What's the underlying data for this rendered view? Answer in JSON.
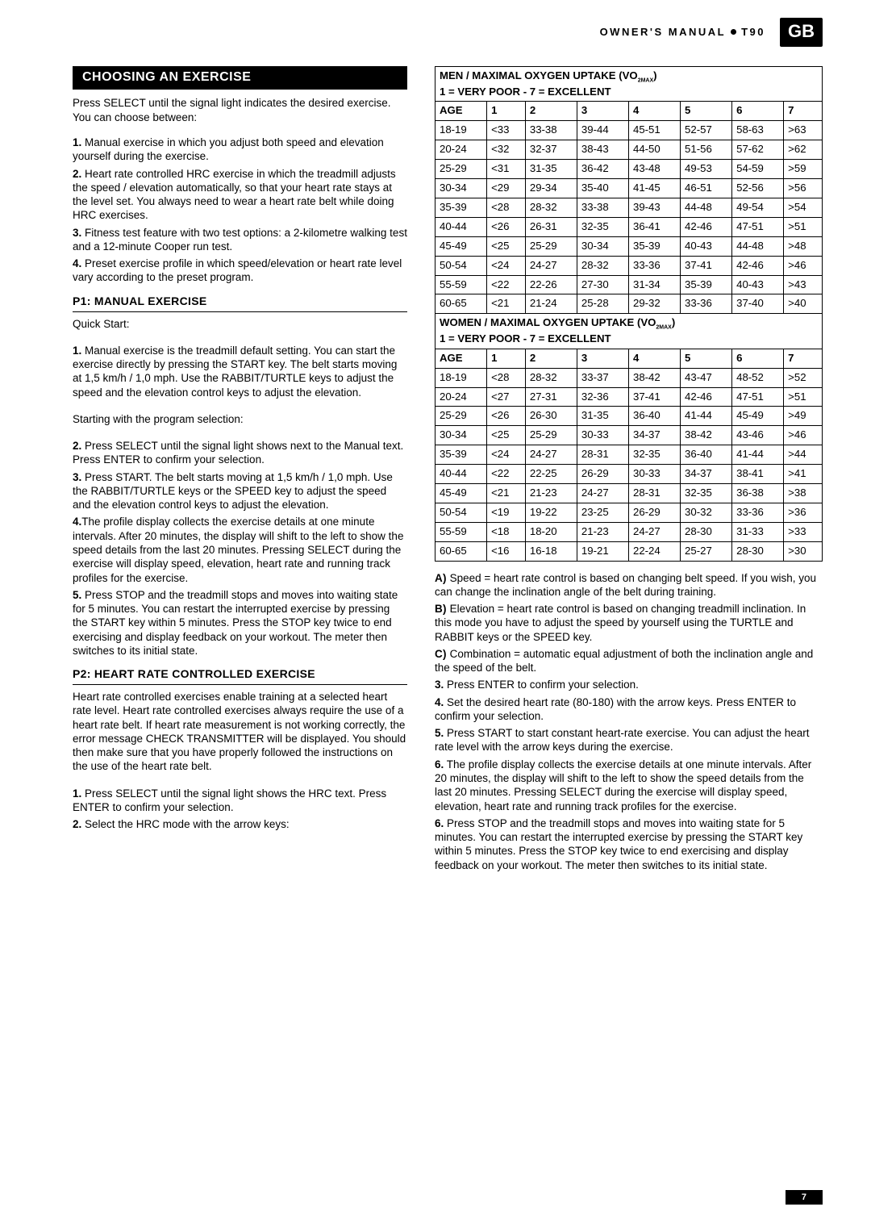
{
  "header": {
    "owner_manual": "OWNER'S MANUAL",
    "model": "T90",
    "lang": "GB"
  },
  "left": {
    "banner": "CHOOSING AN EXERCISE",
    "intro": "Press SELECT until the signal light indicates the desired exercise. You can choose between:",
    "list1_1": "1.",
    "list1_1t": " Manual exercise in which you adjust both speed and elevation yourself during the exercise.",
    "list1_2": "2.",
    "list1_2t": " Heart rate controlled HRC exercise in which the treadmill adjusts the speed / elevation automatically, so that your heart rate stays at the level set. You always need to wear a heart rate belt while doing HRC exercises.",
    "list1_3": "3.",
    "list1_3t": " Fitness test feature with two test options: a 2-kilometre walking test and a 12-minute Cooper run test.",
    "list1_4": "4.",
    "list1_4t": " Preset exercise profile in which speed/elevation or heart rate level vary according to the preset program.",
    "p1_head": "P1: MANUAL EXERCISE",
    "p1_quick": "Quick Start:",
    "p1_1": "1.",
    "p1_1t": " Manual exercise is the treadmill default setting. You can start the exercise directly by pressing the START key. The belt starts moving at 1,5 km/h / 1,0 mph. Use the RABBIT/TURTLE keys to adjust the speed and the elevation control keys to adjust the elevation.",
    "p1_starting": "Starting with the program selection:",
    "p1_2": "2.",
    "p1_2t": " Press SELECT until the signal light shows next to the Manual text. Press ENTER to confirm your selection.",
    "p1_3": "3.",
    "p1_3t": " Press START. The belt starts moving at 1,5 km/h / 1,0 mph. Use the RABBIT/TURTLE keys or the SPEED key to adjust the speed and the elevation control keys to adjust the elevation.",
    "p1_4": "4.",
    "p1_4t": "The profile display collects the exercise details at one minute intervals. After 20 minutes, the display will shift to the left to show the speed details from the last 20 minutes. Pressing SELECT during the exercise will display speed, elevation, heart rate and running track profiles for the exercise.",
    "p1_5": "5.",
    "p1_5t": " Press STOP and the treadmill stops and moves into waiting state for 5 minutes. You can restart the interrupted exercise by pressing the START key within 5 minutes. Press the STOP key twice to end exercising and display feedback on your workout. The meter then switches to its initial state.",
    "p2_head": "P2: HEART RATE CONTROLLED EXERCISE",
    "p2_intro": "Heart rate controlled exercises enable training at a selected heart rate level. Heart rate controlled exercises always require the use of a heart rate belt. If heart rate measurement is not working correctly, the error message CHECK TRANSMITTER will be displayed. You should then make sure that you have properly followed the instructions on the use of the heart rate belt.",
    "p2_1": "1.",
    "p2_1t": " Press SELECT until the signal light shows the HRC text. Press ENTER to confirm your selection.",
    "p2_2": "2.",
    "p2_2t": " Select the HRC mode with the arrow keys:"
  },
  "tables": {
    "men_title_a": "MEN / MAXIMAL OXYGEN UPTAKE (VO",
    "men_title_b": ")",
    "men_sub": "2MAX",
    "scale": "1 = VERY POOR - 7 = EXCELLENT",
    "women_title_a": "WOMEN / MAXIMAL OXYGEN UPTAKE (VO",
    "women_title_b": ")",
    "cols": [
      "AGE",
      "1",
      "2",
      "3",
      "4",
      "5",
      "6",
      "7"
    ],
    "men_rows": [
      [
        "18-19",
        "<33",
        "33-38",
        "39-44",
        "45-51",
        "52-57",
        "58-63",
        ">63"
      ],
      [
        "20-24",
        "<32",
        "32-37",
        "38-43",
        "44-50",
        "51-56",
        "57-62",
        ">62"
      ],
      [
        "25-29",
        "<31",
        "31-35",
        "36-42",
        "43-48",
        "49-53",
        "54-59",
        ">59"
      ],
      [
        "30-34",
        "<29",
        "29-34",
        "35-40",
        "41-45",
        "46-51",
        "52-56",
        ">56"
      ],
      [
        "35-39",
        "<28",
        "28-32",
        "33-38",
        "39-43",
        "44-48",
        "49-54",
        ">54"
      ],
      [
        "40-44",
        "<26",
        "26-31",
        "32-35",
        "36-41",
        "42-46",
        "47-51",
        ">51"
      ],
      [
        "45-49",
        "<25",
        "25-29",
        "30-34",
        "35-39",
        "40-43",
        "44-48",
        ">48"
      ],
      [
        "50-54",
        "<24",
        "24-27",
        "28-32",
        "33-36",
        "37-41",
        "42-46",
        ">46"
      ],
      [
        "55-59",
        "<22",
        "22-26",
        "27-30",
        "31-34",
        "35-39",
        "40-43",
        ">43"
      ],
      [
        "60-65",
        "<21",
        "21-24",
        "25-28",
        "29-32",
        "33-36",
        "37-40",
        ">40"
      ]
    ],
    "women_rows": [
      [
        "18-19",
        "<28",
        "28-32",
        "33-37",
        "38-42",
        "43-47",
        "48-52",
        ">52"
      ],
      [
        "20-24",
        "<27",
        "27-31",
        "32-36",
        "37-41",
        "42-46",
        "47-51",
        ">51"
      ],
      [
        "25-29",
        "<26",
        "26-30",
        "31-35",
        "36-40",
        "41-44",
        "45-49",
        ">49"
      ],
      [
        "30-34",
        "<25",
        "25-29",
        "30-33",
        "34-37",
        "38-42",
        "43-46",
        ">46"
      ],
      [
        "35-39",
        "<24",
        "24-27",
        "28-31",
        "32-35",
        "36-40",
        "41-44",
        ">44"
      ],
      [
        "40-44",
        "<22",
        "22-25",
        "26-29",
        "30-33",
        "34-37",
        "38-41",
        ">41"
      ],
      [
        "45-49",
        "<21",
        "21-23",
        "24-27",
        "28-31",
        "32-35",
        "36-38",
        ">38"
      ],
      [
        "50-54",
        "<19",
        "19-22",
        "23-25",
        "26-29",
        "30-32",
        "33-36",
        ">36"
      ],
      [
        "55-59",
        "<18",
        "18-20",
        "21-23",
        "24-27",
        "28-30",
        "31-33",
        ">33"
      ],
      [
        "60-65",
        "<16",
        "16-18",
        "19-21",
        "22-24",
        "25-27",
        "28-30",
        ">30"
      ]
    ]
  },
  "right": {
    "a_lbl": "A)",
    "a_t": " Speed = heart rate control is based on changing belt speed. If you wish, you can change the inclination angle of the belt during training.",
    "b_lbl": "B)",
    "b_t": " Elevation = heart rate control is based on changing treadmill inclination. In this mode you have to adjust the speed by yourself using the TURTLE and RABBIT keys or the SPEED key.",
    "c_lbl": "C)",
    "c_t": " Combination = automatic equal adjustment of both the inclination angle and the speed of the belt.",
    "r3": "3.",
    "r3t": " Press ENTER to confirm your selection.",
    "r4": "4.",
    "r4t": " Set the desired heart rate (80-180) with the arrow keys. Press ENTER to confirm your selection.",
    "r5": "5.",
    "r5t": " Press START to start constant heart-rate exercise. You can adjust the heart rate level with the arrow keys during the exercise.",
    "r6a": "6.",
    "r6at": " The profile display collects the exercise details at one minute intervals. After 20 minutes, the display will shift to the left to show the speed details from the last 20 minutes. Pressing SELECT during the exercise will display speed, elevation, heart rate and running track profiles for the exercise.",
    "r6b": "6.",
    "r6bt": "  Press STOP and the treadmill stops and moves into waiting state for 5 minutes. You can restart the interrupted exercise by pressing the START key within 5 minutes. Press the STOP key twice to end exercising and display feedback on your workout. The meter then switches to its initial state."
  },
  "pagenum": "7"
}
